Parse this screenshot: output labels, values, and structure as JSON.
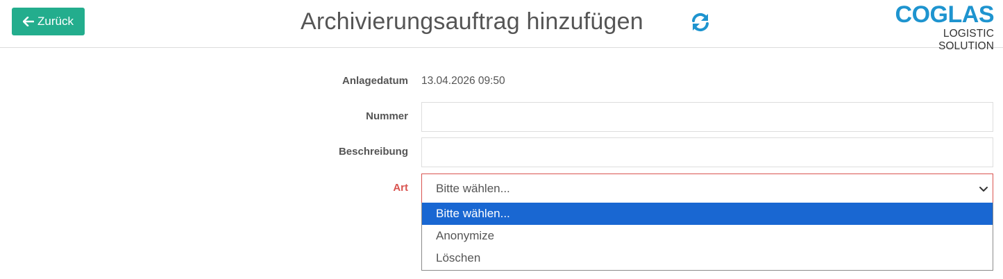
{
  "header": {
    "back_label": "Zurück",
    "title": "Archivierungsauftrag hinzufügen",
    "refresh_icon": "refresh-icon",
    "logo_main": "COGLAS",
    "logo_sub": "LOGISTIC SOLUTION",
    "accent_color": "#23ad8d",
    "brand_color": "#1e94cf"
  },
  "form": {
    "created_label": "Anlagedatum",
    "created_value": "13.04.2026 09:50",
    "number_label": "Nummer",
    "number_value": "",
    "description_label": "Beschreibung",
    "description_value": "",
    "type_label": "Art",
    "type_selected": "Bitte wählen...",
    "type_options": [
      "Bitte wählen...",
      "Anonymize",
      "Löschen"
    ],
    "required_color": "#d9534f",
    "highlight_color": "#1967d2"
  }
}
